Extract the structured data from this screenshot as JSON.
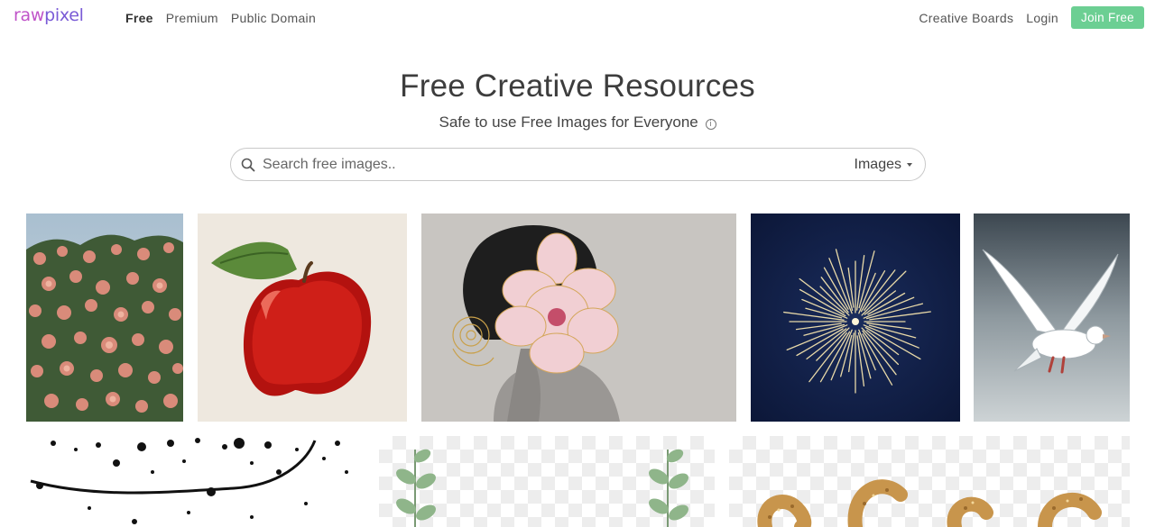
{
  "brand": {
    "logo_text_a": "raw",
    "logo_text_b": "pixel"
  },
  "nav": {
    "left": [
      {
        "label": "Free",
        "active": true
      },
      {
        "label": "Premium",
        "active": false
      },
      {
        "label": "Public Domain",
        "active": false
      }
    ],
    "right": {
      "boards_label": "Creative Boards",
      "login_label": "Login",
      "join_label": "Join Free"
    }
  },
  "hero": {
    "title": "Free Creative Resources",
    "subtitle": "Safe to use Free Images for Everyone"
  },
  "search": {
    "placeholder": "Search free images..",
    "type_selected": "Images"
  },
  "colors": {
    "accent_green": "#6ccf93",
    "logo_pink": "#c054c9",
    "logo_purple": "#7a5bd6"
  },
  "images": [
    {
      "name": "pink-roses-bush"
    },
    {
      "name": "red-apple-illustration"
    },
    {
      "name": "woman-with-flower-face"
    },
    {
      "name": "fireworks-night-sky"
    },
    {
      "name": "white-dove-flying"
    },
    {
      "name": "black-ink-splatter"
    },
    {
      "name": "green-leaf-branches"
    },
    {
      "name": "glitter-letters"
    }
  ]
}
